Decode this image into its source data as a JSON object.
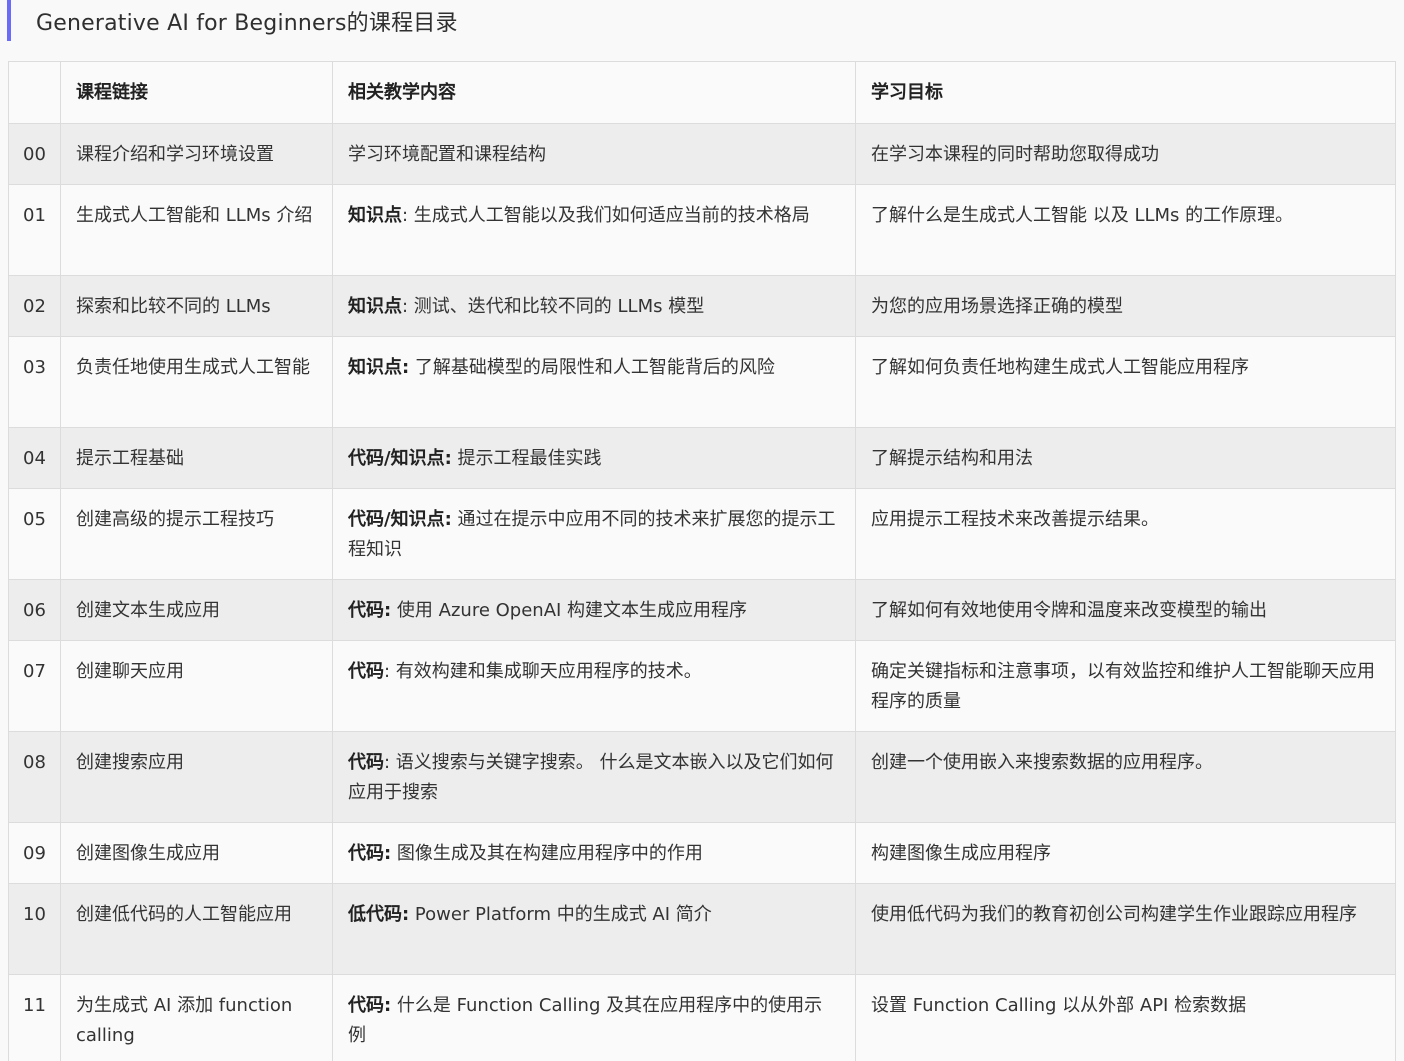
{
  "page_title": "Generative AI for Beginners的课程目录",
  "table": {
    "headers": [
      "",
      "课程链接",
      "相关教学内容",
      "学习目标"
    ],
    "rows": [
      {
        "num": "00",
        "link": "课程介绍和学习环境设置",
        "content_label": "",
        "content_text": "学习环境配置和课程结构",
        "goal": "在学习本课程的同时帮助您取得成功"
      },
      {
        "num": "01",
        "link": "生成式人工智能和 LLMs 介绍",
        "content_label": "知识点",
        "content_text": ": 生成式人工智能以及我们如何适应当前的技术格局",
        "goal": "了解什么是生成式人工智能 以及 LLMs 的工作原理。"
      },
      {
        "num": "02",
        "link": "探索和比较不同的 LLMs",
        "content_label": "知识点",
        "content_text": ": 测试、迭代和比较不同的 LLMs 模型",
        "goal": "为您的应用场景选择正确的模型"
      },
      {
        "num": "03",
        "link": "负责任地使用生成式人工智能",
        "content_label": "知识点:",
        "content_text": " 了解基础模型的局限性和人工智能背后的风险",
        "goal": "了解如何负责任地构建生成式人工智能应用程序"
      },
      {
        "num": "04",
        "link": "提示工程基础",
        "content_label": "代码/知识点:",
        "content_text": " 提示工程最佳实践",
        "goal": "了解提示结构和用法"
      },
      {
        "num": "05",
        "link": "创建高级的提示工程技巧",
        "content_label": "代码/知识点:",
        "content_text": " 通过在提示中应用不同的技术来扩展您的提示工程知识",
        "goal": "应用提示工程技术来改善提示结果。"
      },
      {
        "num": "06",
        "link": "创建文本生成应用",
        "content_label": "代码:",
        "content_text": " 使用 Azure OpenAI 构建文本生成应用程序",
        "goal": "了解如何有效地使用令牌和温度来改变模型的输出"
      },
      {
        "num": "07",
        "link": "创建聊天应用",
        "content_label": "代码",
        "content_text": ": 有效构建和集成聊天应用程序的技术。",
        "goal": "确定关键指标和注意事项，以有效监控和维护人工智能聊天应用程序的质量"
      },
      {
        "num": "08",
        "link": "创建搜索应用",
        "content_label": "代码",
        "content_text": ": 语义搜索与关键字搜索。 什么是文本嵌入以及它们如何应用于搜索",
        "goal": "创建一个使用嵌入来搜索数据的应用程序。"
      },
      {
        "num": "09",
        "link": "创建图像生成应用",
        "content_label": "代码:",
        "content_text": " 图像生成及其在构建应用程序中的作用",
        "goal": "构建图像生成应用程序"
      },
      {
        "num": "10",
        "link": "创建低代码的人工智能应用",
        "content_label": "低代码:",
        "content_text": " Power Platform 中的生成式 AI 简介",
        "goal": "使用低代码为我们的教育初创公司构建学生作业跟踪应用程序"
      },
      {
        "num": "11",
        "link": "为生成式 AI 添加 function calling",
        "content_label": "代码:",
        "content_text": " 什么是 Function Calling 及其在应用程序中的使用示例",
        "goal": "设置 Function Calling 以从外部 API 检索数据"
      }
    ]
  }
}
